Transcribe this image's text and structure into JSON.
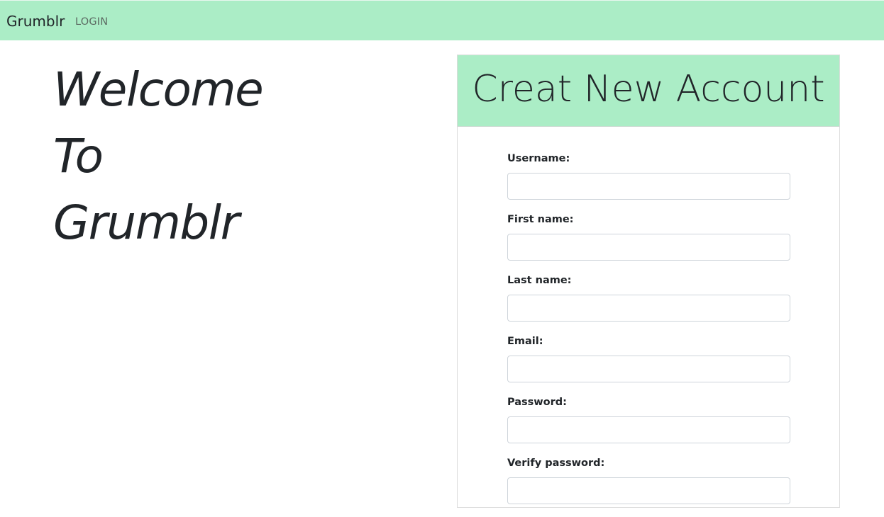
{
  "navbar": {
    "brand": "Grumblr",
    "login_link": "LOGIN",
    "background": "#abedc6"
  },
  "hero": {
    "line1": "Welcome",
    "line2": "To",
    "line3": "Grumblr"
  },
  "signup": {
    "title": "Creat New Account",
    "header_background": "#abedc6",
    "fields": [
      {
        "label": "Username:",
        "value": "",
        "placeholder": ""
      },
      {
        "label": "First name:",
        "value": "",
        "placeholder": ""
      },
      {
        "label": "Last name:",
        "value": "",
        "placeholder": ""
      },
      {
        "label": "Email:",
        "value": "",
        "placeholder": ""
      },
      {
        "label": "Password:",
        "value": "",
        "placeholder": ""
      },
      {
        "label": "Verify password:",
        "value": "",
        "placeholder": ""
      }
    ]
  }
}
